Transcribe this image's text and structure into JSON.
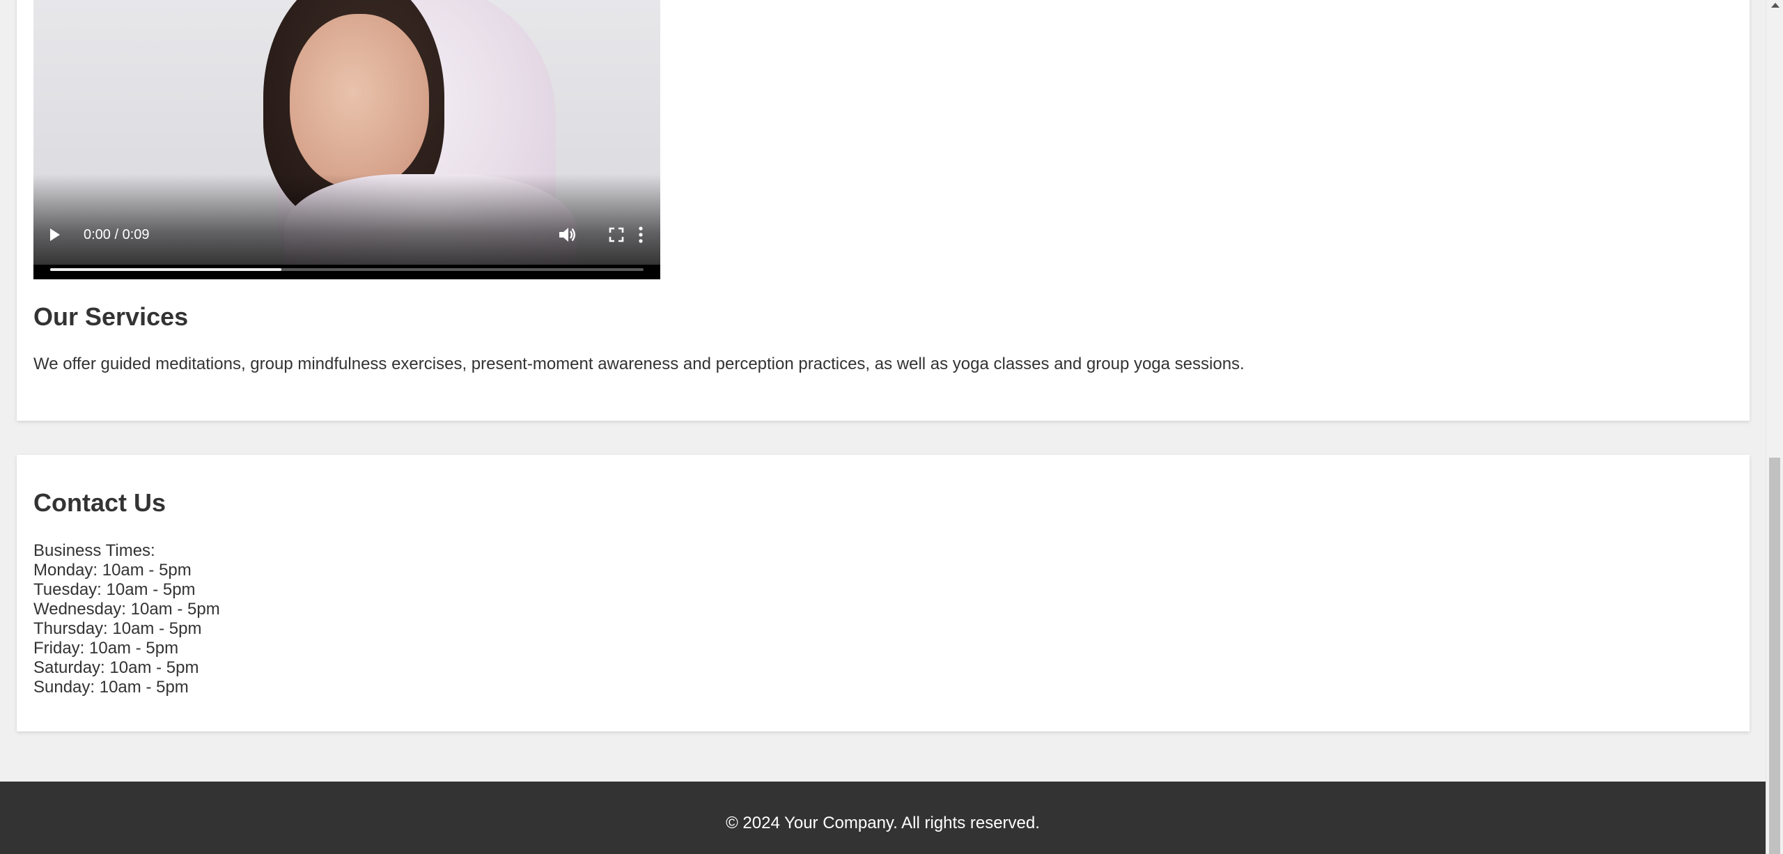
{
  "video": {
    "time_display": "0:00 / 0:09",
    "progress_fraction": 0.39,
    "controls": {
      "play_icon": "play-icon",
      "volume_icon": "volume-icon",
      "fullscreen_icon": "fullscreen-icon",
      "more_icon": "more-options-icon"
    }
  },
  "services": {
    "title": "Our Services",
    "description": "We offer guided meditations, group mindfulness exercises, present-moment awareness and perception practices, as well as yoga classes and group yoga sessions."
  },
  "contact": {
    "title": "Contact Us",
    "business_times_label": "Business Times:",
    "hours": [
      "Monday: 10am - 5pm",
      "Tuesday: 10am - 5pm",
      "Wednesday: 10am - 5pm",
      "Thursday: 10am - 5pm",
      "Friday: 10am - 5pm",
      "Saturday: 10am - 5pm",
      "Sunday: 10am - 5pm"
    ]
  },
  "footer": {
    "text": "© 2024 Your Company. All rights reserved."
  },
  "colors": {
    "page_background": "#f0f0f0",
    "card_background": "#ffffff",
    "footer_background": "#333333",
    "text": "#333333"
  }
}
